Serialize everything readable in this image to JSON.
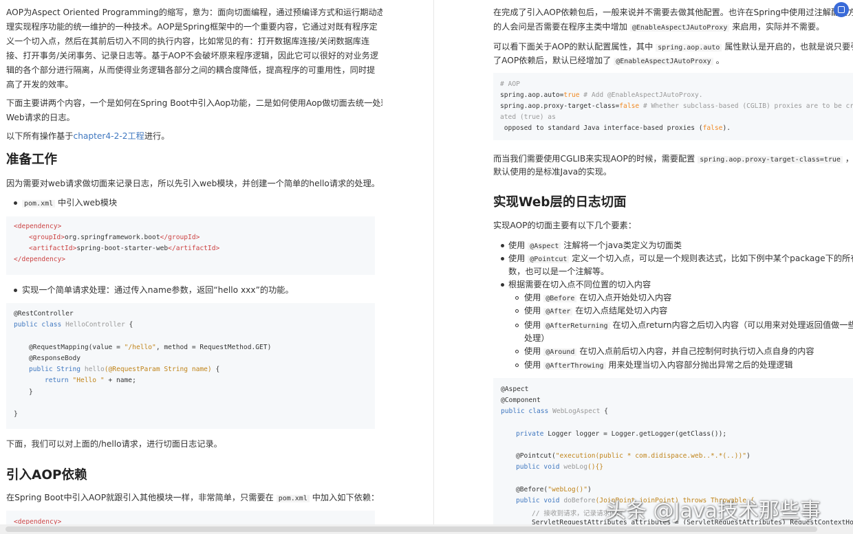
{
  "left": {
    "intro": [
      "AOP为Aspect Oriented Programming的缩写，意为：面向切面编程，通过预编译方式和运行期动态代",
      "理实现程序功能的统一维护的一种技术。AOP是Spring框架中的一个重要内容，它通过对既有程序定",
      "义一个切入点，然后在其前后切入不同的执行内容，比如常见的有：打开数据库连接/关闭数据库连",
      "接、打开事务/关闭事务、记录日志等。基于AOP不会破坏原来程序逻辑，因此它可以很好的对业务逻",
      "辑的各个部分进行隔离，从而使得业务逻辑各部分之间的耦合度降低，提高程序的可重用性，同时提",
      "高了开发的效率。"
    ],
    "para2": [
      "下面主要讲两个内容，一个是如何在Spring Boot中引入Aop功能，二是如何使用Aop做切面去统一处理",
      "Web请求的日志。"
    ],
    "based_prefix": "以下所有操作基于",
    "based_link": "chapter4-2-2工程",
    "based_suffix": "进行。",
    "h_prepare": "准备工作",
    "prepare_text": "因为需要对web请求做切面来记录日志，所以先引入web模块，并创建一个简单的hello请求的处理。",
    "bullet1_code": "pom.xml",
    "bullet1_text": "中引入web模块",
    "dep": {
      "open": "<dependency>",
      "g_open": "<groupId>",
      "g_val": "org.springframework.boot",
      "g_close": "</groupId>",
      "a_open": "<artifactId>",
      "a_val": "spring-boot-starter-web",
      "a_close": "</artifactId>",
      "close": "</dependency>"
    },
    "bullet2_text": "实现一个简单请求处理：通过传入name参数，返回“hello xxx”的功能。",
    "hello": {
      "l1": "@RestController",
      "l2_kw": "public class",
      "l2_name": " HelloController",
      "l2_rest": " {",
      "l3_a": "@RequestMapping(value = ",
      "l3_str": "\"/hello\"",
      "l3_b": ", method = RequestMethod.GET)",
      "l4": "@ResponseBody",
      "l5_kw": "public String",
      "l5_name": " hello",
      "l5_param": "(@RequestParam String name)",
      "l5_rest": " {",
      "l6_kw": "return",
      "l6_str": " \"Hello \"",
      "l6_rest": " + name;",
      "l7": "}",
      "l8": "}"
    },
    "after_hello": "下面，我们可以对上面的/hello请求，进行切面日志记录。",
    "h_aop": "引入AOP依赖",
    "aop_prefix": "在Spring Boot中引入AOP就跟引入其他模块一样，非常简单，只需要在",
    "aop_code": "pom.xml",
    "aop_suffix": "中加入如下依赖：",
    "dep2_partial": "<dependency>"
  },
  "right": {
    "p1_l1": "在完成了引入AOP依赖包后，一般来说并不需要去做其他配置。也许在Spring中使用过注解配置方式",
    "p1_l2_a": "的人会问是否需要在程序主类中增加",
    "p1_l2_code": "@EnableAspectJAutoProxy",
    "p1_l2_b": "来启用，实际并不需要。",
    "p2_l1_a": "可以看下面关于AOP的默认配置属性，其中",
    "p2_l1_code": "spring.aop.auto",
    "p2_l1_b": "属性默认是开启的，也就是说只要引入",
    "p2_l2_a": "了AOP依赖后，默认已经增加了",
    "p2_l2_code": "@EnableAspectJAutoProxy",
    "p2_l2_b": "。",
    "props": {
      "c1": "# AOP",
      "k1": "spring.aop.auto=",
      "v1": "true",
      "c2": " # Add @EnableAspectJAutoProxy.",
      "k2": "spring.aop.proxy-target-class=",
      "v2": "false",
      "c3": " # Whether subclass-based (CGLIB) proxies are to be cre",
      "c4": "ated (true) as",
      "l5_a": " opposed to standard Java interface-based proxies (",
      "l5_v": "false",
      "l5_b": ")."
    },
    "p3_l1_a": "而当我们需要使用CGLIB来实现AOP的时候，需要配置",
    "p3_l1_code": "spring.aop.proxy-target-class=true",
    "p3_l1_b": "，不然",
    "p3_l2": "默认使用的是标准Java的实现。",
    "h_weblog": "实现Web层的日志切面",
    "elements_intro": "实现AOP的切面主要有以下几个要素：",
    "b1_a": "使用",
    "b1_code": "@Aspect",
    "b1_b": "注解将一个java类定义为切面类",
    "b2_a": "使用",
    "b2_code": "@Pointcut",
    "b2_b": "定义一个切入点，可以是一个规则表达式，比如下例中某个package下的所有函",
    "b2_l2": "数，也可以是一个注解等。",
    "b3": "根据需要在切入点不同位置的切入内容",
    "s1_a": "使用",
    "s1_code": "@Before",
    "s1_b": "在切入点开始处切入内容",
    "s2_a": "使用",
    "s2_code": "@After",
    "s2_b": "在切入点结尾处切入内容",
    "s3_a": "使用",
    "s3_code": "@AfterReturning",
    "s3_b": "在切入点return内容之后切入内容（可以用来对处理返回值做一些加工",
    "s3_l2": "处理）",
    "s4_a": "使用",
    "s4_code": "@Around",
    "s4_b": "在切入点前后切入内容，并自己控制何时执行切入点自身的内容",
    "s5_a": "使用",
    "s5_code": "@AfterThrowing",
    "s5_b": "用来处理当切入内容部分抛出异常之后的处理逻辑",
    "weblog": {
      "l1": "@Aspect",
      "l2": "@Component",
      "l3_kw": "public class",
      "l3_name": " WebLogAspect",
      "l3_rest": " {",
      "l4_kw": "private",
      "l4_rest": " Logger logger = Logger.getLogger(getClass());",
      "l5_a": "@Pointcut(",
      "l5_str": "\"execution(public * com.didispace.web..*.*(..))\"",
      "l5_b": ")",
      "l6_kw": "public void",
      "l6_name": " webLog",
      "l6_rest": "(){}",
      "l7_a": "@Before(",
      "l7_str": "\"webLog()\"",
      "l7_b": ")",
      "l8_kw": "public void",
      "l8_name": " doBefore",
      "l8_rest": "(JoinPoint joinPoint) throws Throwable {",
      "l9": "// 接收到请求，记录请求内容",
      "l10": "ServletRequestAttributes attributes = (ServletRequestAttributes) RequestContextHolder"
    }
  },
  "watermark": "头条 @Java技术那些事"
}
